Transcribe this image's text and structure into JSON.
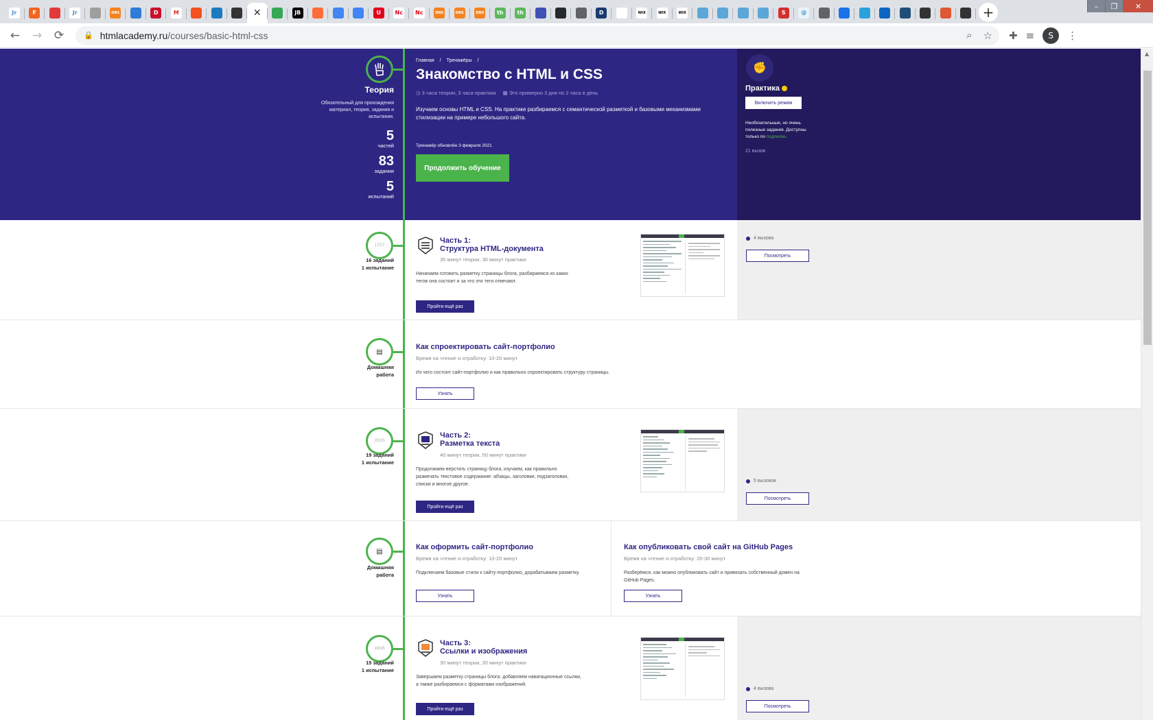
{
  "browser": {
    "tabs": [
      {
        "icon": "jr-icon",
        "text": "Jr",
        "bg": "#ffffff",
        "fg": "#4a90d9"
      },
      {
        "icon": "f-icon",
        "text": "F",
        "bg": "#f26522",
        "fg": "#ffffff"
      },
      {
        "icon": "circle-icon",
        "text": "",
        "bg": "#e03a3a",
        "fg": "#ffffff"
      },
      {
        "icon": "jr-icon",
        "text": "Jr",
        "bg": "#ffffff",
        "fg": "#4a90d9"
      },
      {
        "icon": "gear-icon",
        "text": "",
        "bg": "#9e9e9e",
        "fg": "#ffffff"
      },
      {
        "icon": "dns-icon",
        "text": "DNS",
        "bg": "#f58220",
        "fg": "#ffffff"
      },
      {
        "icon": "drop-icon",
        "text": "",
        "bg": "#2f7bd8",
        "fg": "#ffffff"
      },
      {
        "icon": "d-icon",
        "text": "D",
        "bg": "#c8102e",
        "fg": "#ffffff"
      },
      {
        "icon": "gmail-icon",
        "text": "M",
        "bg": "#ffffff",
        "fg": "#d93025"
      },
      {
        "icon": "bars-icon",
        "text": "",
        "bg": "#f4511e",
        "fg": "#ffffff"
      },
      {
        "icon": "leaf-icon",
        "text": "",
        "bg": "#1a7bbf",
        "fg": "#ffffff"
      },
      {
        "icon": "shield-icon",
        "text": "",
        "bg": "#333333",
        "fg": "#ffffff"
      },
      {
        "icon": "close-icon",
        "text": "",
        "bg": "#ffffff",
        "fg": "#333333"
      },
      {
        "icon": "drive-icon",
        "text": "",
        "bg": "#34a853",
        "fg": "#ffffff"
      },
      {
        "icon": "jb-icon",
        "text": "JB",
        "bg": "#000000",
        "fg": "#ffffff"
      },
      {
        "icon": "c-icon",
        "text": "",
        "bg": "#ff6d3a",
        "fg": "#ffffff"
      },
      {
        "icon": "doc-icon",
        "text": "",
        "bg": "#4285f4",
        "fg": "#ffffff"
      },
      {
        "icon": "doc-icon",
        "text": "",
        "bg": "#4285f4",
        "fg": "#ffffff"
      },
      {
        "icon": "u-icon",
        "text": "U",
        "bg": "#e3001b",
        "fg": "#ffffff"
      },
      {
        "icon": "nc-icon",
        "text": "Nc",
        "bg": "#ffffff",
        "fg": "#e3001b"
      },
      {
        "icon": "nc-icon",
        "text": "Nc",
        "bg": "#ffffff",
        "fg": "#e3001b"
      },
      {
        "icon": "dns-icon",
        "text": "DNS",
        "bg": "#f58220",
        "fg": "#ffffff"
      },
      {
        "icon": "dns-icon",
        "text": "DNS",
        "bg": "#f58220",
        "fg": "#ffffff"
      },
      {
        "icon": "dns-icon",
        "text": "DNS",
        "bg": "#f58220",
        "fg": "#ffffff"
      },
      {
        "icon": "th-icon",
        "text": "th",
        "bg": "#5cb85c",
        "fg": "#ffffff"
      },
      {
        "icon": "th-icon",
        "text": "th",
        "bg": "#5cb85c",
        "fg": "#ffffff"
      },
      {
        "icon": "layers-icon",
        "text": "",
        "bg": "#3f51b5",
        "fg": "#ffffff"
      },
      {
        "icon": "github-icon",
        "text": "",
        "bg": "#24292e",
        "fg": "#ffffff"
      },
      {
        "icon": "globe-icon",
        "text": "",
        "bg": "#5f6368",
        "fg": "#ffffff"
      },
      {
        "icon": "d-icon",
        "text": "D",
        "bg": "#1a3a6e",
        "fg": "#ffffff"
      },
      {
        "icon": "dots-icon",
        "text": "",
        "bg": "#ffffff",
        "fg": "#1a3a6e"
      },
      {
        "icon": "wix-icon",
        "text": "WIX",
        "bg": "#ffffff",
        "fg": "#000000"
      },
      {
        "icon": "wix-icon",
        "text": "WIX",
        "bg": "#ffffff",
        "fg": "#000000"
      },
      {
        "icon": "wix-icon",
        "text": "WIX",
        "bg": "#ffffff",
        "fg": "#000000"
      },
      {
        "icon": "puzzle-icon",
        "text": "",
        "bg": "#5aa7d8",
        "fg": "#ffffff"
      },
      {
        "icon": "puzzle-icon",
        "text": "",
        "bg": "#5aa7d8",
        "fg": "#ffffff"
      },
      {
        "icon": "puzzle-icon",
        "text": "",
        "bg": "#5aa7d8",
        "fg": "#ffffff"
      },
      {
        "icon": "puzzle-icon",
        "text": "",
        "bg": "#5aa7d8",
        "fg": "#ffffff"
      },
      {
        "icon": "s-icon",
        "text": "S",
        "bg": "#d32f2f",
        "fg": "#ffffff"
      },
      {
        "icon": "at-icon",
        "text": "@",
        "bg": "#e8f4fb",
        "fg": "#3c8dbc"
      },
      {
        "icon": "globe-icon",
        "text": "",
        "bg": "#5f6368",
        "fg": "#ffffff"
      },
      {
        "icon": "diamond-icon",
        "text": "",
        "bg": "#1a73e8",
        "fg": "#ffffff"
      },
      {
        "icon": "telegram-icon",
        "text": "",
        "bg": "#2aa1da",
        "fg": "#ffffff"
      },
      {
        "icon": "stack-icon",
        "text": "",
        "bg": "#0a66c2",
        "fg": "#ffffff"
      },
      {
        "icon": "grid-icon",
        "text": "",
        "bg": "#1f4e79",
        "fg": "#ffffff"
      },
      {
        "icon": "shield-icon",
        "text": "",
        "bg": "#333333",
        "fg": "#ffffff"
      },
      {
        "icon": "duck-icon",
        "text": "",
        "bg": "#de5833",
        "fg": "#ffffff"
      },
      {
        "icon": "shield-icon",
        "text": "",
        "bg": "#333333",
        "fg": "#ffffff"
      }
    ],
    "active_tab_index": 12,
    "new_tab_label": "+",
    "window_controls": {
      "minimize": "–",
      "maximize": "❐",
      "close": "✕"
    },
    "url_host": "htmlacademy.ru",
    "url_path": "/courses/basic-html-css",
    "profile_initial": "S"
  },
  "hero": {
    "theory_label": "Теория",
    "theory_desc": "Обязательный для прохождения материал, теория, задания и испытания.",
    "stats": [
      {
        "num": "5",
        "unit": "частей"
      },
      {
        "num": "83",
        "unit": "задания"
      },
      {
        "num": "5",
        "unit": "испытаний"
      }
    ],
    "breadcrumbs": [
      "Главная",
      "/",
      "Тренажёры",
      "/"
    ],
    "title": "Знакомство с HTML и CSS",
    "meta_time": "3 часа теории, 3 часа практики",
    "meta_days": "Это примерно 3 дня по 2 часа в день",
    "description": "Изучаем основы HTML и CSS. На практике разбираемся с семантической разметкой и базовыми механизмами стилизации на примере небольшого сайта.",
    "updated": "Тренажёр обновлён 3 февраля 2021",
    "cta": "Продолжить обучение",
    "practice_title": "Практика",
    "practice_button": "Включить режим",
    "practice_desc_1": "Необязательные, но очень полезные задания. Доступны только по",
    "practice_desc_link": "подписке",
    "practice_desc_end": ".",
    "practice_count": "21 вызов"
  },
  "chapters": [
    {
      "node": "17/17",
      "left_label_1": "16 заданий",
      "left_label_2": "1 испытание",
      "part": "Часть 1:",
      "title": "Структура HTML-документа",
      "meta": "35 минут теории, 30 минут практики",
      "desc": "Начинаем готовить разметку страницы блога, разбираемся из каких тегов она состоит и за что эти теги отвечают.",
      "button": "Пройти ещё раз",
      "challenges": "4 вызова",
      "challenges_button": "Посмотреть"
    },
    {
      "node": "20/20",
      "left_label_1": "19 заданий",
      "left_label_2": "1 испытание",
      "part": "Часть 2:",
      "title": "Разметка текста",
      "meta": "40 минут теории, 50 минут практики",
      "desc": "Продолжаем верстать страницу блога, изучаем, как правильно размечать текстовое содержание: абзацы, заголовки, подзаголовки, списки и многое другое.",
      "button": "Пройти ещё раз",
      "challenges": "5 вызовов",
      "challenges_button": "Посмотреть"
    },
    {
      "node": "16/16",
      "left_label_1": "15 заданий",
      "left_label_2": "1 испытание",
      "part": "Часть 3:",
      "title": "Ссылки и изображения",
      "meta": "30 минут теории, 30 минут практики",
      "desc": "Завершаем разметку страницы блога: добавляем навигационные ссылки, а также разбираемся с форматами изображений.",
      "button": "Пройти ещё раз",
      "challenges": "4 вызова",
      "challenges_button": "Посмотреть"
    }
  ],
  "homework": [
    {
      "label_1": "Домашняя",
      "label_2": "работа",
      "items": [
        {
          "title": "Как спроектировать сайт-портфолио",
          "meta": "Время на чтение и отработку: 10-20 минут",
          "desc": "Из чего состоит сайт-портфолио и как правильно спроектировать структуру страницы.",
          "button": "Узнать"
        }
      ]
    },
    {
      "label_1": "Домашняя",
      "label_2": "работа",
      "items": [
        {
          "title": "Как оформить сайт-портфолио",
          "meta": "Время на чтение и отработку: 10-20 минут",
          "desc": "Подключаем базовые стили к сайту-портфолио, дорабатываем разметку.",
          "button": "Узнать"
        },
        {
          "title": "Как опубликовать свой сайт на GitHub Pages",
          "meta": "Время на чтение и отработку: 20-30 минут",
          "desc": "Разберёмся, как можно опубликовать сайт и привязать собственный домен на GitHub Pages.",
          "button": "Узнать"
        }
      ]
    }
  ],
  "colors": {
    "hero_bg": "#2e2683",
    "practice_bg": "#221a5c",
    "accent_green": "#4bb34b",
    "text_navy": "#2e2683"
  }
}
